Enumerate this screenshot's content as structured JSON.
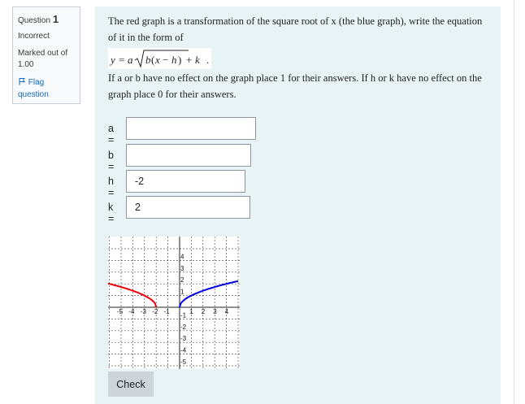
{
  "info": {
    "question_label": "Question",
    "question_number": "1",
    "state": "Incorrect",
    "grade": "Marked out of 1.00",
    "flag_label": "Flag question"
  },
  "question": {
    "text_1": "The red graph is a transformation of the square root of x (the blue graph), write the equation of it in the form of",
    "text_2": "If a or b have no effect on the graph place 1 for their answers. If h or k have no effect on the graph place 0 for their answers.",
    "formula": "y = a√(b(x − h)) + k"
  },
  "answers": [
    {
      "label": "a =",
      "value": ""
    },
    {
      "label": "b =",
      "value": ""
    },
    {
      "label": "h =",
      "value": "-2"
    },
    {
      "label": "k =",
      "value": "2"
    }
  ],
  "graph": {
    "x_ticks": [
      "-5",
      "-4",
      "-3",
      "-2",
      "-1",
      "1",
      "2",
      "3",
      "4"
    ],
    "y_ticks": [
      "4",
      "3",
      "2",
      "1",
      "-1",
      "-2",
      "-3",
      "-4",
      "-5"
    ],
    "colors": {
      "red": "#e8000b",
      "blue": "#0000e0"
    }
  },
  "check_label": "Check"
}
